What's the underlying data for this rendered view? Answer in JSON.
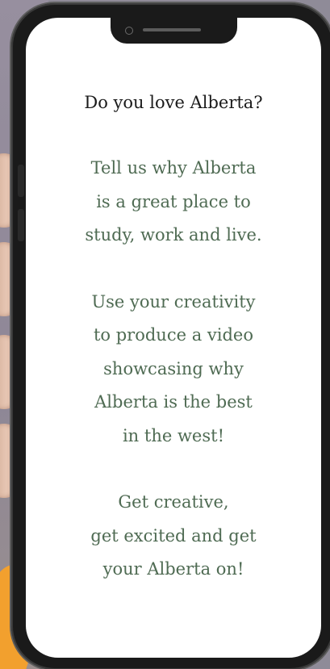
{
  "phone": {
    "screen": {
      "headline": "Do you love Alberta?",
      "paragraphs": [
        [
          "Tell us why Alberta",
          "is a great place to",
          "study, work and live."
        ],
        [
          "Use your creativity",
          "to produce a video",
          "showcasing why",
          "Alberta is the best",
          "in the west!"
        ],
        [
          "Get creative,",
          "get excited and get",
          "your Alberta on!"
        ]
      ]
    }
  },
  "colors": {
    "background": "#8f8b98",
    "phone_frame": "#1a1a1a",
    "screen": "#ffffff",
    "headline_text": "#1b1b1b",
    "body_text": "#4f6b53"
  }
}
